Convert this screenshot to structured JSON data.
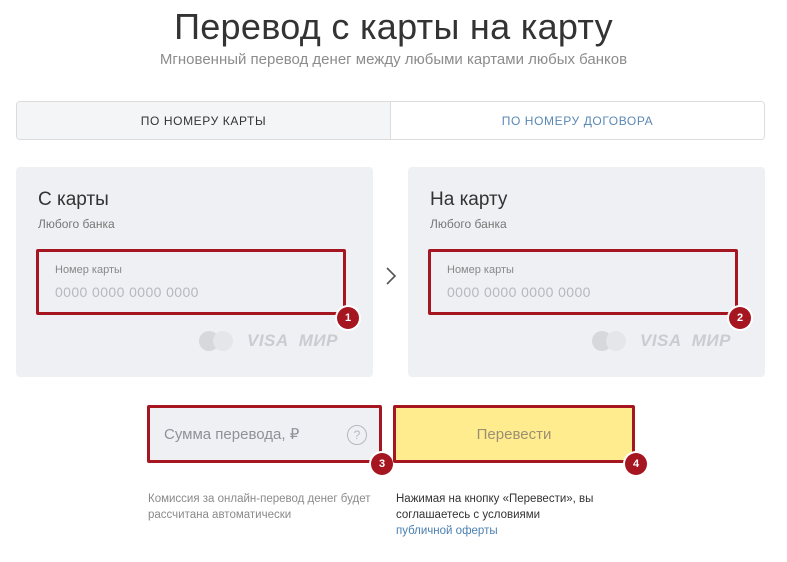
{
  "header": {
    "title": "Перевод с карты на карту",
    "subtitle": "Мгновенный перевод денег между любыми картами любых банков"
  },
  "tabs": [
    {
      "label": "ПО НОМЕРУ КАРТЫ",
      "active": true
    },
    {
      "label": "ПО НОМЕРУ ДОГОВОРА",
      "active": false
    }
  ],
  "from_card": {
    "title": "С карты",
    "subtitle": "Любого банка",
    "field_label": "Номер карты",
    "placeholder": "0000 0000 0000 0000",
    "value": "",
    "badge": "1"
  },
  "to_card": {
    "title": "На карту",
    "subtitle": "Любого банка",
    "field_label": "Номер карты",
    "placeholder": "0000 0000 0000 0000",
    "value": "",
    "badge": "2"
  },
  "payment_logos": {
    "mastercard_icon": "mastercard-logo-icon",
    "visa": "VISA",
    "mir": "МИР"
  },
  "amount": {
    "placeholder": "Сумма перевода, ₽",
    "value": "",
    "help_symbol": "?",
    "badge": "3"
  },
  "submit": {
    "label": "Перевести",
    "badge": "4"
  },
  "notes": {
    "commission": "Комиссия за онлайн-перевод денег будет рассчитана автоматически",
    "agreement_text": "Нажимая на кнопку «Перевести», вы соглашаетесь с условиями",
    "offer_link": "публичной оферты"
  },
  "colors": {
    "highlight_border": "#a61620",
    "panel_bg": "#eef0f4",
    "button_bg": "#ffec8f",
    "link": "#4a7fb0"
  }
}
